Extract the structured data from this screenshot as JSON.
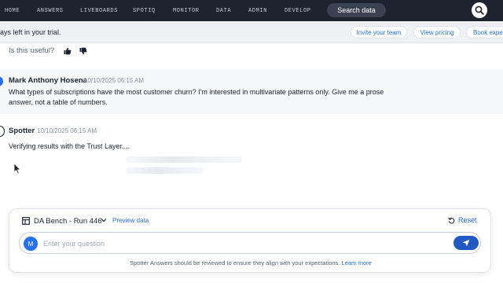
{
  "nav": {
    "items": [
      "HOME",
      "ANSWERS",
      "LIVEBOARDS",
      "SPOTIQ",
      "MONITOR",
      "DATA",
      "ADMIN",
      "DEVELOP"
    ],
    "search_label": "Search data",
    "search_icon": "search-icon"
  },
  "trial": {
    "text": "ays left in your trial.",
    "invite_label": "Invite your team",
    "pricing_label": "View pricing",
    "book_label": "Book expe"
  },
  "feedback": {
    "prompt": "Is this useful?",
    "like_icon": "thumbs-up-icon",
    "dislike_icon": "thumbs-down-icon"
  },
  "messages": {
    "user": {
      "name": "Mark Anthony Hosena",
      "time": "10/10/2025 06:15 AM",
      "line1": "What types of subscriptions have the most customer churn? I'm interested in multivariate patterns only. Give me a prose",
      "line2": "answer, not a table of numbers."
    },
    "spotter": {
      "name": "Spotter",
      "time": "10/10/2025 06:15 AM",
      "status": "Verifying results with the Trust Layer...."
    }
  },
  "composer": {
    "workspace": "DA Bench - Run 446",
    "preview_label": "Preview data",
    "reset_label": "Reset",
    "avatar_initial": "M",
    "placeholder": "Enter your question",
    "input_value": "",
    "disclaimer": "Spotter Answers should be reviewed to ensure they align with your expectations.",
    "learn_more": "Learn more"
  },
  "colors": {
    "nav_bg": "#1d232f",
    "accent": "#2770ef",
    "send_bg": "#2159c4"
  }
}
